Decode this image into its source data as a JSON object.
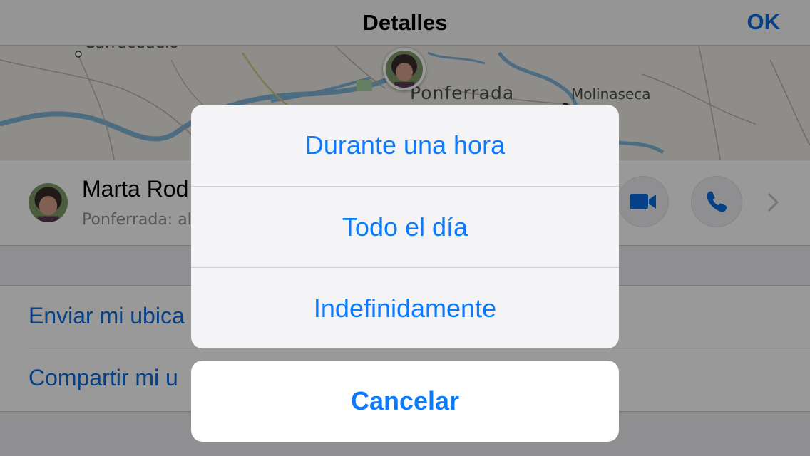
{
  "navbar": {
    "title": "Detalles",
    "ok_label": "OK"
  },
  "map": {
    "labels": {
      "carracedelo": "Carracedelo",
      "ponferrada": "Ponferrada",
      "molinaseca": "Molinaseca"
    }
  },
  "contact": {
    "name": "Marta Rod",
    "subtitle": "Ponferrada: al"
  },
  "actions": {
    "video_icon": "video-camera-icon",
    "call_icon": "phone-icon"
  },
  "list": {
    "send_location": "Enviar mi ubica",
    "share_location": "Compartir mi u"
  },
  "action_sheet": {
    "options": [
      "Durante una hora",
      "Todo el día",
      "Indefinidamente"
    ],
    "cancel_label": "Cancelar"
  },
  "colors": {
    "accent": "#0a7aff",
    "nav_accent": "#0a6be0"
  }
}
